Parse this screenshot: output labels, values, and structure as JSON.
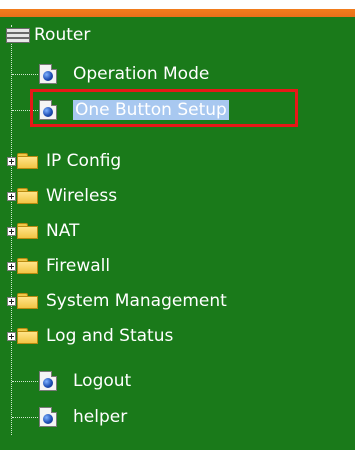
{
  "tree": {
    "root_label": "Router",
    "items": [
      {
        "label": "Operation Mode"
      },
      {
        "label": "One Button Setup"
      },
      {
        "label": "IP Config"
      },
      {
        "label": "Wireless"
      },
      {
        "label": "NAT"
      },
      {
        "label": "Firewall"
      },
      {
        "label": "System Management"
      },
      {
        "label": "Log and Status"
      },
      {
        "label": "Logout"
      },
      {
        "label": "helper"
      }
    ]
  },
  "icons": {
    "root": "router-icon",
    "page": "page-globe-icon",
    "folder": "folder-icon",
    "expander": "plus-expander-icon"
  },
  "colors": {
    "background": "#1a7a1a",
    "top_bar": "#f27d1c",
    "selection": "#a8c8f0",
    "highlight_border": "#e81818"
  }
}
